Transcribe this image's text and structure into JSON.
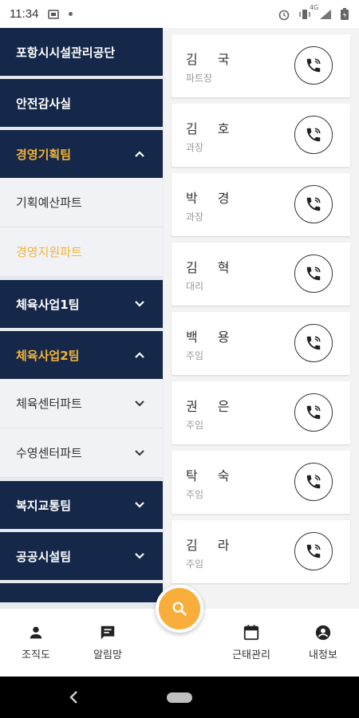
{
  "status_bar": {
    "time": "11:34",
    "network": "4G"
  },
  "sidebar": {
    "items": [
      {
        "label": "포항시시설관리공단",
        "kind": "dept",
        "open": false,
        "chevron": "none"
      },
      {
        "label": "안전감사실",
        "kind": "dept",
        "open": false,
        "chevron": "none"
      },
      {
        "label": "경영기획팀",
        "kind": "dept",
        "open": true,
        "chevron": "chevron-up-icon"
      },
      {
        "label": "기획예산파트",
        "kind": "sub",
        "active": false,
        "chevron": "none"
      },
      {
        "label": "경영지원파트",
        "kind": "sub",
        "active": true,
        "chevron": "none"
      },
      {
        "label": "체육사업1팀",
        "kind": "dept",
        "open": false,
        "chevron": "chevron-down-icon"
      },
      {
        "label": "체육사업2팀",
        "kind": "dept",
        "open": true,
        "chevron": "chevron-up-icon"
      },
      {
        "label": "체육센터파트",
        "kind": "sub",
        "active": false,
        "chevron": "chevron-down-icon"
      },
      {
        "label": "수영센터파트",
        "kind": "sub",
        "active": false,
        "chevron": "chevron-down-icon"
      },
      {
        "label": "복지교통팀",
        "kind": "dept",
        "open": false,
        "chevron": "chevron-down-icon"
      },
      {
        "label": "공공시설팀",
        "kind": "dept",
        "open": false,
        "chevron": "chevron-down-icon"
      }
    ]
  },
  "contacts": [
    {
      "name": "김 국",
      "title": "파트장"
    },
    {
      "name": "김 호",
      "title": "과장"
    },
    {
      "name": "박 경",
      "title": "과장"
    },
    {
      "name": "김 혁",
      "title": "대리"
    },
    {
      "name": "백 용",
      "title": "주임"
    },
    {
      "name": "권 은",
      "title": "주임"
    },
    {
      "name": "탁 숙",
      "title": "주임"
    },
    {
      "name": "김 라",
      "title": "주임"
    }
  ],
  "bottom_nav": {
    "org": "조직도",
    "notice": "알림망",
    "attendance": "근태관리",
    "myinfo": "내정보"
  },
  "colors": {
    "navy": "#15284a",
    "accent": "#f5b335",
    "fab": "#f9ae3c"
  }
}
